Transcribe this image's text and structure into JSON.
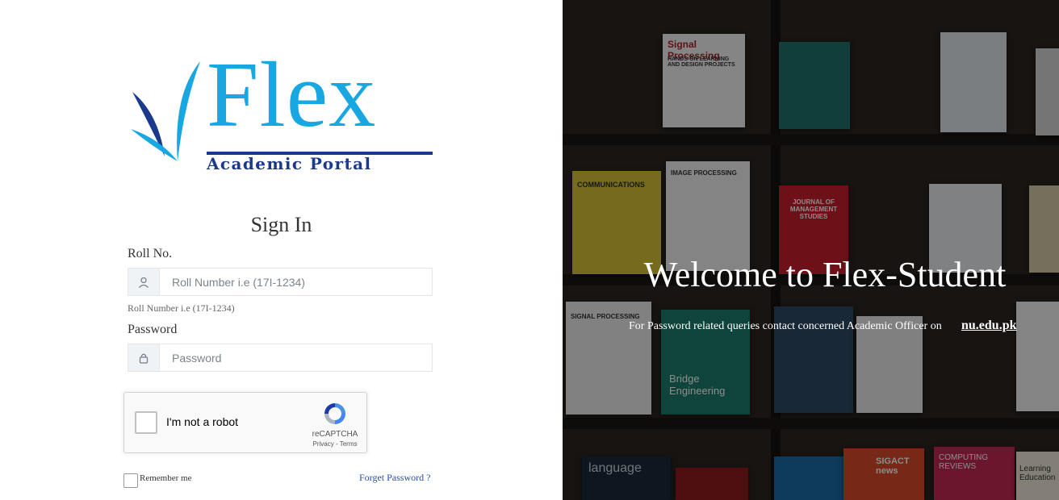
{
  "logo": {
    "word": "Flex",
    "subtitle": "Academic Portal",
    "colors": {
      "primary": "#18a7e0",
      "dark": "#1b3a8e"
    }
  },
  "signin": {
    "title": "Sign In",
    "roll_label": "Roll No.",
    "roll_placeholder": "Roll Number i.e (17I-1234)",
    "roll_help": "Roll Number i.e (17I-1234)",
    "password_label": "Password",
    "password_placeholder": "Password",
    "user_icon": "user-icon",
    "lock_icon": "lock-icon"
  },
  "captcha": {
    "label": "I'm not a robot",
    "brand": "reCAPTCHA",
    "links": "Privacy - Terms"
  },
  "footer": {
    "remember_label": "Remember me",
    "forget_label": "Forget Password ?"
  },
  "banner": {
    "welcome": "Welcome to Flex-Student",
    "note": "For Password related queries contact concerned Academic Officer on",
    "link": "nu.edu.pk"
  },
  "books": {
    "signal": "Signal Processing",
    "signal_sub": "HANDS-ON LEARNING AND DESIGN PROJECTS",
    "communications": "COMMUNICATIONS",
    "image": "IMAGE PROCESSING",
    "journal": "JOURNAL OF MANAGEMENT STUDIES",
    "signal2": "SIGNAL PROCESSING",
    "bridge": "Bridge Engineering",
    "sigact": "SIGACT news",
    "computing": "COMPUTING REVIEWS",
    "learning": "Learning Education",
    "language": "language"
  }
}
